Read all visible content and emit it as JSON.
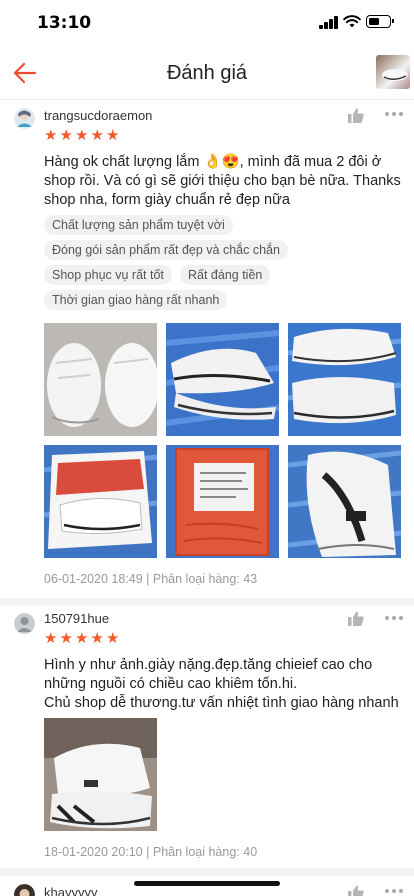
{
  "status_bar": {
    "time": "13:10"
  },
  "header": {
    "title": "Đánh giá"
  },
  "reviews": [
    {
      "username": "trangsucdoraemon",
      "rating": 5,
      "text": "Hàng ok chất lượng lắm 👌😍, mình đã mua 2 đôi ở shop rồi. Và có gì sẽ giới thiệu cho bạn bè nữa. Thanks shop nha, form giày chuẩn rẻ đẹp nữa",
      "tags": [
        "Chất lượng sản phẩm tuyệt vời",
        "Đóng gói sản phẩm rất đẹp và chắc chắn",
        "Shop phục vụ rất tốt",
        "Rất đáng tiền",
        "Thời gian giao hàng rất nhanh"
      ],
      "meta": "06-01-2020 18:49 | Phân loại hàng: 43"
    },
    {
      "username": "150791hue",
      "rating": 5,
      "text": "Hình y như ảnh.giày nặng.đẹp.tăng chieief cao cho những nguồi có chiều cao khiêm tốn.hi.\nChủ shop dễ thương.tư vấn nhiệt tình giao hàng nhanh",
      "meta": "18-01-2020 20:10 | Phân loại hàng: 40"
    },
    {
      "username": "khayyyyy"
    }
  ],
  "colors": {
    "accent": "#ee4d2d",
    "star": "#f25a2a"
  }
}
